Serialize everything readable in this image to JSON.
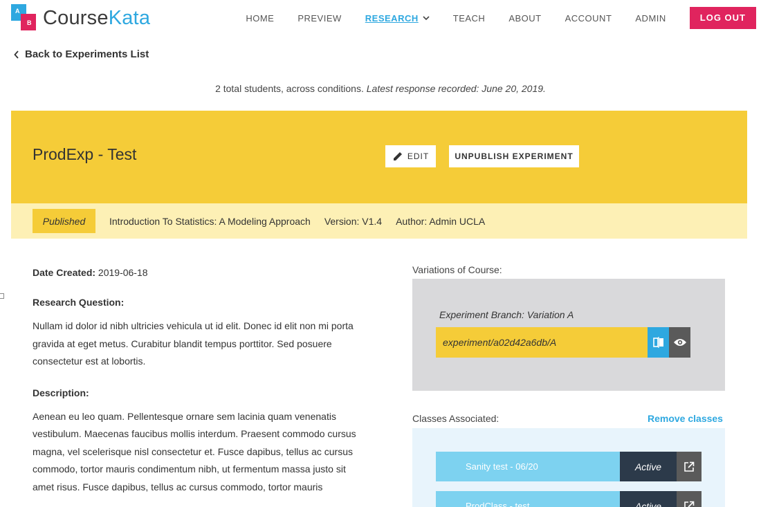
{
  "header": {
    "logo_text_a": "Course",
    "logo_text_b": "Kata",
    "logo_mark_a": "A",
    "logo_mark_b": "B",
    "brand_blue": "#2ea8e0",
    "brand_pink": "#e0245e",
    "nav": {
      "home": "HOME",
      "preview": "PREVIEW",
      "research": "RESEARCH",
      "teach": "TEACH",
      "about": "ABOUT",
      "account": "ACCOUNT",
      "admin": "ADMIN"
    },
    "logout_label": "LOG OUT"
  },
  "back_link": "Back to Experiments List",
  "summary": {
    "count_text": "2 total students, across conditions.",
    "latest_text": "Latest response recorded: June 20, 2019."
  },
  "experiment": {
    "title": "ProdExp - Test",
    "edit_label": "EDIT",
    "unpublish_label": "UNPUBLISH EXPERIMENT",
    "status": "Published",
    "course": "Introduction To Statistics: A Modeling Approach",
    "version": "Version: V1.4",
    "author": "Author: Admin UCLA",
    "accent_yellow": "#f5cc38"
  },
  "details": {
    "date_label": "Date Created:",
    "date_value": "2019-06-18",
    "question_heading": "Research Question:",
    "question_lines": [
      "Nullam id dolor id nibh ultricies vehicula ut id elit. Donec id elit non mi porta",
      "gravida at eget metus. Curabitur blandit tempus porttitor. Sed posuere",
      "consectetur est at lobortis."
    ],
    "description_heading": "Description:",
    "description_lines": [
      "Aenean eu leo quam. Pellentesque ornare sem lacinia quam venenatis",
      "vestibulum. Maecenas faucibus mollis interdum. Praesent commodo cursus",
      "magna, vel scelerisque nisl consectetur et. Fusce dapibus, tellus ac cursus",
      "commodo, tortor mauris condimentum nibh, ut fermentum massa justo sit",
      "amet risus. Fusce dapibus, tellus ac cursus commodo, tortor mauris"
    ]
  },
  "variations": {
    "label": "Variations of Course:",
    "branch_label": "Experiment Branch: Variation A",
    "branch_name": "experiment/a02d42a6db/A",
    "compare_icon": "compare-icon",
    "view_icon": "eye-icon"
  },
  "classes": {
    "label": "Classes Associated:",
    "remove_label": "Remove classes",
    "items": [
      {
        "name": "Sanity test - 06/20",
        "status": "Active"
      },
      {
        "name": "ProdClass - test",
        "status": "Active"
      }
    ]
  }
}
